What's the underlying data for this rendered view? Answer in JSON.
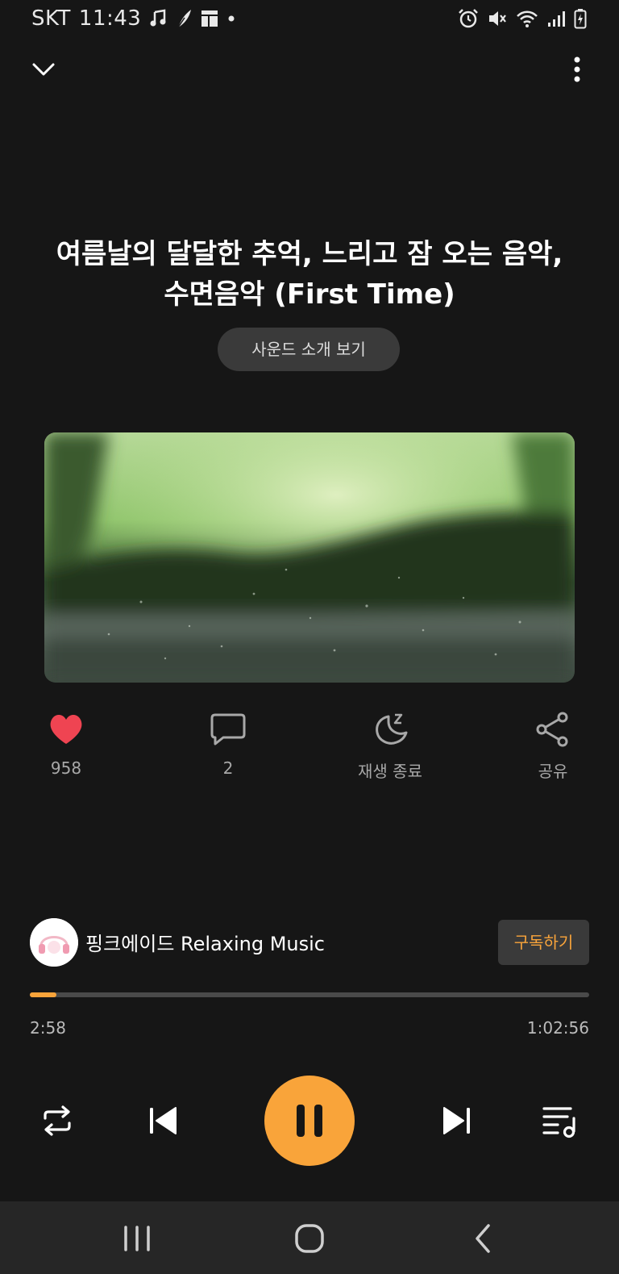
{
  "status_bar": {
    "carrier": "SKT",
    "time": "11:43",
    "left_icons": [
      "music-note-icon",
      "feather-icon",
      "grid-icon",
      "dot-icon"
    ],
    "right_icons": [
      "alarm-icon",
      "mute-icon",
      "wifi-icon",
      "signal-icon",
      "battery-charging-icon"
    ]
  },
  "top_bar": {
    "collapse_icon": "chevron-down-icon",
    "more_icon": "more-vertical-icon"
  },
  "track": {
    "title": "여름날의 달달한 추억, 느리고 잠 오는 음악,\n수면음악 (First Time)",
    "intro_button": "사운드 소개 보기"
  },
  "actions": {
    "like_count": "958",
    "comment_count": "2",
    "sleep_label": "재생 종료",
    "share_label": "공유"
  },
  "channel": {
    "name": "핑크에이드 Relaxing Music",
    "subscribe_label": "구독하기"
  },
  "playback": {
    "elapsed": "2:58",
    "total": "1:02:56",
    "progress_fraction": 0.047,
    "state": "playing"
  },
  "colors": {
    "accent": "#f9a43a",
    "background": "#161616",
    "like": "#ef4452",
    "pill": "#3a3a3a"
  },
  "nav_bar": {
    "icons": [
      "recent-apps-icon",
      "home-icon",
      "back-icon"
    ]
  }
}
